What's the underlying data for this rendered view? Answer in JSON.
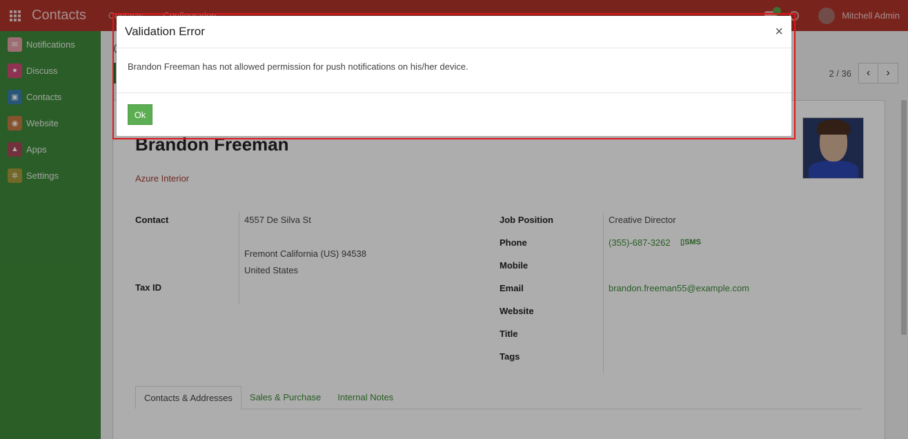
{
  "topbar": {
    "app_title": "Contacts",
    "menu": [
      "Contacts",
      "Configuration"
    ],
    "user_name": "Mitchell Admin"
  },
  "sidebar": {
    "items": [
      {
        "label": "Notifications",
        "icon": "notification-icon",
        "color": "#e8a1a8"
      },
      {
        "label": "Discuss",
        "icon": "chat-bubble-icon",
        "color": "#d44c7a"
      },
      {
        "label": "Contacts",
        "icon": "address-book-icon",
        "color": "#3a7fb0"
      },
      {
        "label": "Website",
        "icon": "globe-icon",
        "color": "#c87a45"
      },
      {
        "label": "Apps",
        "icon": "cubes-icon",
        "color": "#a8495a"
      },
      {
        "label": "Settings",
        "icon": "gear-icon",
        "color": "#a89a3a"
      }
    ]
  },
  "control_panel": {
    "breadcrumb": "C",
    "pager_value": "2 / 36"
  },
  "record": {
    "name": "Brandon Freeman",
    "company": "Azure Interior",
    "labels": {
      "contact": "Contact",
      "tax_id": "Tax ID",
      "job_position": "Job Position",
      "phone": "Phone",
      "mobile": "Mobile",
      "email": "Email",
      "website": "Website",
      "title": "Title",
      "tags": "Tags"
    },
    "address": {
      "street": "4557 De Silva St",
      "city_line": "Fremont  California (US)  94538",
      "country": "United States"
    },
    "job_position": "Creative Director",
    "phone": "(355)-687-3262",
    "sms_label": "SMS",
    "email": "brandon.freeman55@example.com"
  },
  "tabs": [
    {
      "label": "Contacts & Addresses",
      "active": true
    },
    {
      "label": "Sales & Purchase",
      "active": false
    },
    {
      "label": "Internal Notes",
      "active": false
    }
  ],
  "dialog": {
    "title": "Validation Error",
    "close": "×",
    "message": "Brandon Freeman has not allowed permission for push notifications on his/her device.",
    "ok_label": "Ok"
  },
  "colors": {
    "topbar": "#b3342b",
    "sidebar": "#3f8a3a",
    "accent_green": "#5cae52",
    "highlight_red": "#e0171b"
  }
}
